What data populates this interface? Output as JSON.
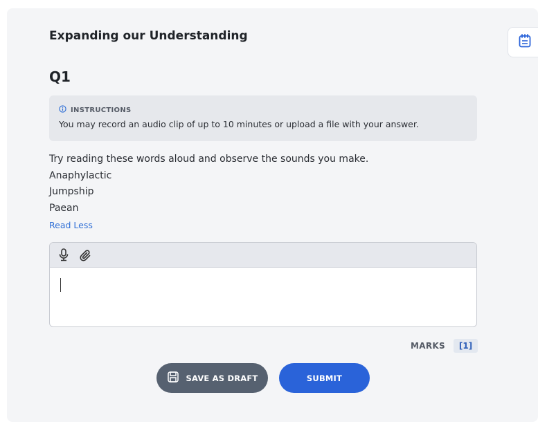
{
  "assignment": {
    "title": "Expanding our Understanding"
  },
  "question": {
    "number": "Q1",
    "instructions": {
      "heading": "INSTRUCTIONS",
      "text": "You may record an audio clip of up to 10 minutes or upload a file with your answer."
    },
    "prompt_lines": [
      "Try reading these words aloud and observe the sounds you make.",
      "Anaphylactic",
      "Jumpship",
      "Paean"
    ],
    "toggle_label": "Read Less"
  },
  "answer": {
    "value": ""
  },
  "marks": {
    "label": "MARKS",
    "value": "[1]"
  },
  "actions": {
    "save_draft": "SAVE AS DRAFT",
    "submit": "SUBMIT"
  },
  "icons": {
    "notes": "notes-icon",
    "mic": "microphone-icon",
    "attach": "paperclip-icon",
    "save": "save-icon",
    "info": "info-icon"
  },
  "colors": {
    "primary": "#2a63d9",
    "secondary": "#566170",
    "link": "#2f6fd6"
  }
}
